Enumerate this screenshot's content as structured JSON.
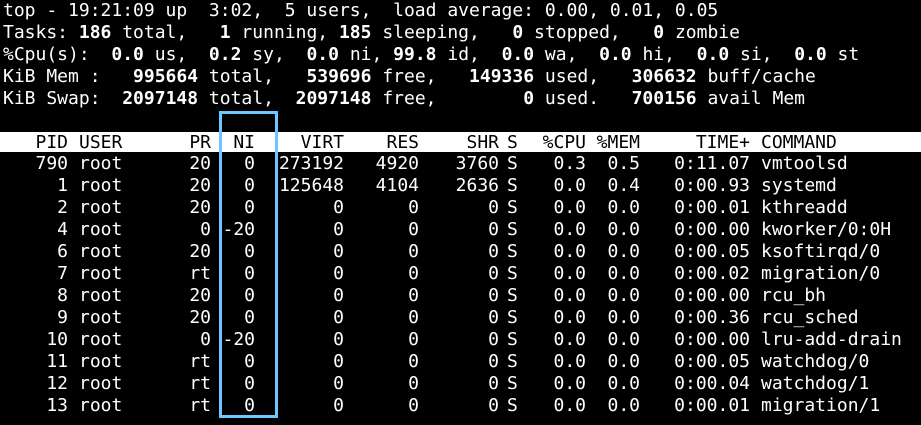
{
  "summary": {
    "line1": "top - 19:21:09 up  3:02,  5 users,  load average: 0.00, 0.01, 0.05",
    "tasks": {
      "prefix": "Tasks: ",
      "total": "186",
      "total_label": " total,   ",
      "running": "1",
      "running_label": " running, ",
      "sleeping": "185",
      "sleeping_label": " sleeping,   ",
      "stopped": "0",
      "stopped_label": " stopped,   ",
      "zombie": "0",
      "zombie_label": " zombie"
    },
    "cpu": {
      "prefix": "%Cpu(s):  ",
      "us": "0.0",
      "us_label": " us,  ",
      "sy": "0.2",
      "sy_label": " sy,  ",
      "ni": "0.0",
      "ni_label": " ni, ",
      "id": "99.8",
      "id_label": " id,  ",
      "wa": "0.0",
      "wa_label": " wa,  ",
      "hi": "0.0",
      "hi_label": " hi,  ",
      "si": "0.0",
      "si_label": " si,  ",
      "st": "0.0",
      "st_label": " st"
    },
    "mem": {
      "prefix": "KiB Mem :   ",
      "total": "995664",
      "total_label": " total,   ",
      "free": "539696",
      "free_label": " free,   ",
      "used": "149336",
      "used_label": " used,   ",
      "buff": "306632",
      "buff_label": " buff/cache"
    },
    "swap": {
      "prefix": "KiB Swap:  ",
      "total": "2097148",
      "total_label": " total,  ",
      "free": "2097148",
      "free_label": " free,        ",
      "used": "0",
      "used_label": " used.   ",
      "avail": "700156",
      "avail_label": " avail Mem"
    }
  },
  "columns": [
    "PID",
    "USER",
    "PR",
    "NI",
    "VIRT",
    "RES",
    "SHR",
    "S",
    "%CPU",
    "%MEM",
    "TIME+",
    "COMMAND"
  ],
  "processes": [
    [
      "790",
      "root",
      "20",
      "0",
      "273192",
      "4920",
      "3760",
      "S",
      "0.3",
      "0.5",
      "0:11.07",
      "vmtoolsd"
    ],
    [
      "1",
      "root",
      "20",
      "0",
      "125648",
      "4104",
      "2636",
      "S",
      "0.0",
      "0.4",
      "0:00.93",
      "systemd"
    ],
    [
      "2",
      "root",
      "20",
      "0",
      "0",
      "0",
      "0",
      "S",
      "0.0",
      "0.0",
      "0:00.01",
      "kthreadd"
    ],
    [
      "4",
      "root",
      "0",
      "-20",
      "0",
      "0",
      "0",
      "S",
      "0.0",
      "0.0",
      "0:00.00",
      "kworker/0:0H"
    ],
    [
      "6",
      "root",
      "20",
      "0",
      "0",
      "0",
      "0",
      "S",
      "0.0",
      "0.0",
      "0:00.05",
      "ksoftirqd/0"
    ],
    [
      "7",
      "root",
      "rt",
      "0",
      "0",
      "0",
      "0",
      "S",
      "0.0",
      "0.0",
      "0:00.02",
      "migration/0"
    ],
    [
      "8",
      "root",
      "20",
      "0",
      "0",
      "0",
      "0",
      "S",
      "0.0",
      "0.0",
      "0:00.00",
      "rcu_bh"
    ],
    [
      "9",
      "root",
      "20",
      "0",
      "0",
      "0",
      "0",
      "S",
      "0.0",
      "0.0",
      "0:00.36",
      "rcu_sched"
    ],
    [
      "10",
      "root",
      "0",
      "-20",
      "0",
      "0",
      "0",
      "S",
      "0.0",
      "0.0",
      "0:00.00",
      "lru-add-drain"
    ],
    [
      "11",
      "root",
      "rt",
      "0",
      "0",
      "0",
      "0",
      "S",
      "0.0",
      "0.0",
      "0:00.05",
      "watchdog/0"
    ],
    [
      "12",
      "root",
      "rt",
      "0",
      "0",
      "0",
      "0",
      "S",
      "0.0",
      "0.0",
      "0:00.04",
      "watchdog/1"
    ],
    [
      "13",
      "root",
      "rt",
      "0",
      "0",
      "0",
      "0",
      "S",
      "0.0",
      "0.0",
      "0:00.01",
      "migration/1"
    ]
  ],
  "colors": {
    "background": "#000000",
    "text": "#ffffff",
    "header_bg": "#ffffff",
    "header_text": "#000000",
    "highlight_box": "#6ec6ff"
  }
}
